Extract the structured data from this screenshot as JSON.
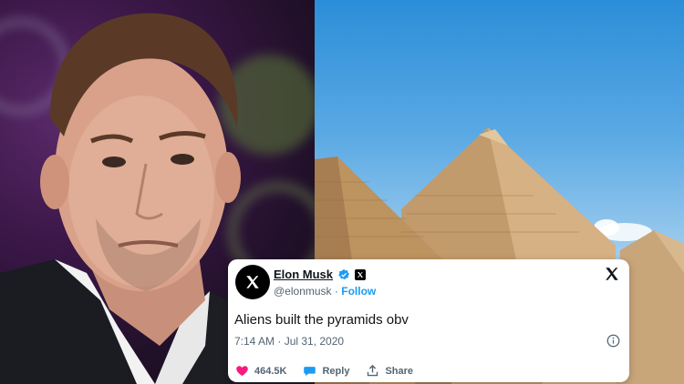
{
  "tweet": {
    "name": "Elon Musk",
    "handle": "@elonmusk",
    "separator": "·",
    "follow_label": "Follow",
    "text": "Aliens built the pyramids obv",
    "timestamp": "7:14 AM · Jul 31, 2020",
    "likes": "464.5K",
    "reply_label": "Reply",
    "share_label": "Share"
  },
  "colors": {
    "accent": "#1d9bf0",
    "like": "#f91880",
    "text_primary": "#0f1419",
    "text_secondary": "#536471"
  },
  "icons": [
    "x-logo-icon",
    "verified-badge-icon",
    "close-icon",
    "info-icon",
    "heart-icon",
    "reply-bubble-icon",
    "share-icon"
  ]
}
